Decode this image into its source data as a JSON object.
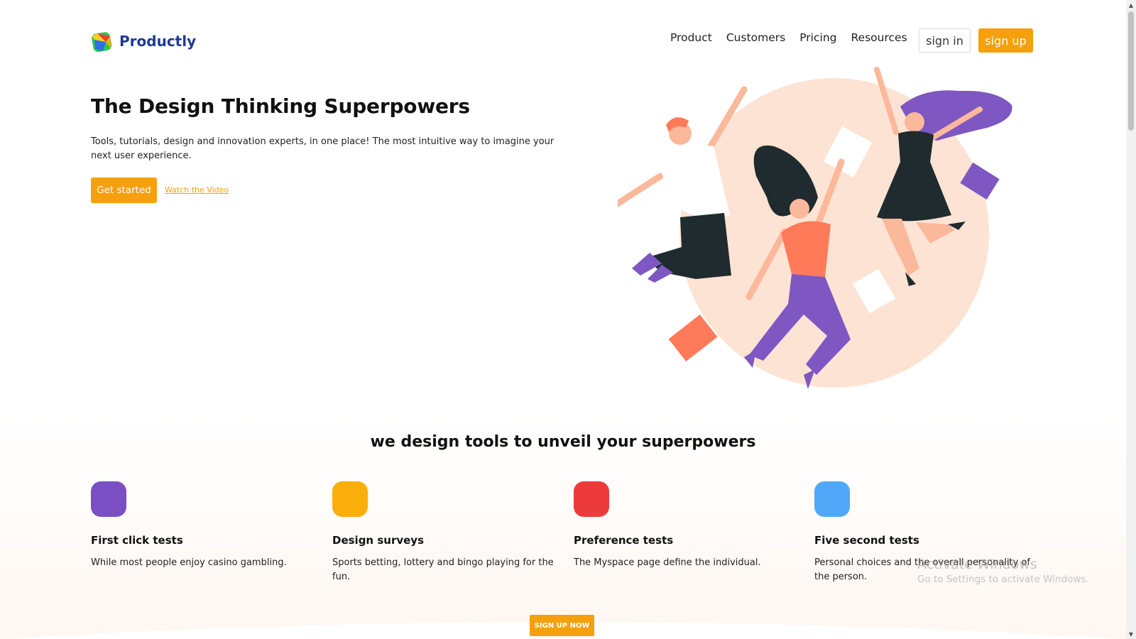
{
  "brand": {
    "name": "Productly",
    "colors": {
      "primary": "#f5a00c",
      "brand_text": "#1f3a93"
    }
  },
  "nav": {
    "items": [
      "Product",
      "Customers",
      "Pricing",
      "Resources"
    ],
    "sign_in": "sign in",
    "sign_up": "sign up"
  },
  "hero": {
    "title": "The Design Thinking Superpowers",
    "description": "Tools, tutorials, design and innovation experts, in one place! The most intuitive way to imagine your next user experience.",
    "cta": "Get started",
    "video_link": "Watch the Video"
  },
  "features": {
    "title": "we design tools to unveil your superpowers",
    "items": [
      {
        "name": "First click tests",
        "description": "While most people enjoy casino gambling.",
        "color": "#7b4fc4"
      },
      {
        "name": "Design surveys",
        "description": "Sports betting, lottery and bingo playing for the fun.",
        "color": "#f9ae0a"
      },
      {
        "name": "Preference tests",
        "description": "The Myspace page define the individual.",
        "color": "#ed3b3b"
      },
      {
        "name": "Five second tests",
        "description": "Personal choices and the overall personality of the person.",
        "color": "#4fa8f7"
      }
    ],
    "cta": "SIGN UP NOW"
  },
  "watermark": {
    "title": "Activate Windows",
    "subtitle": "Go to Settings to activate Windows."
  },
  "icons": {
    "logo": "productly-logo-icon",
    "scroll_up": "chevron-up-icon",
    "scroll_down": "chevron-down-icon"
  }
}
